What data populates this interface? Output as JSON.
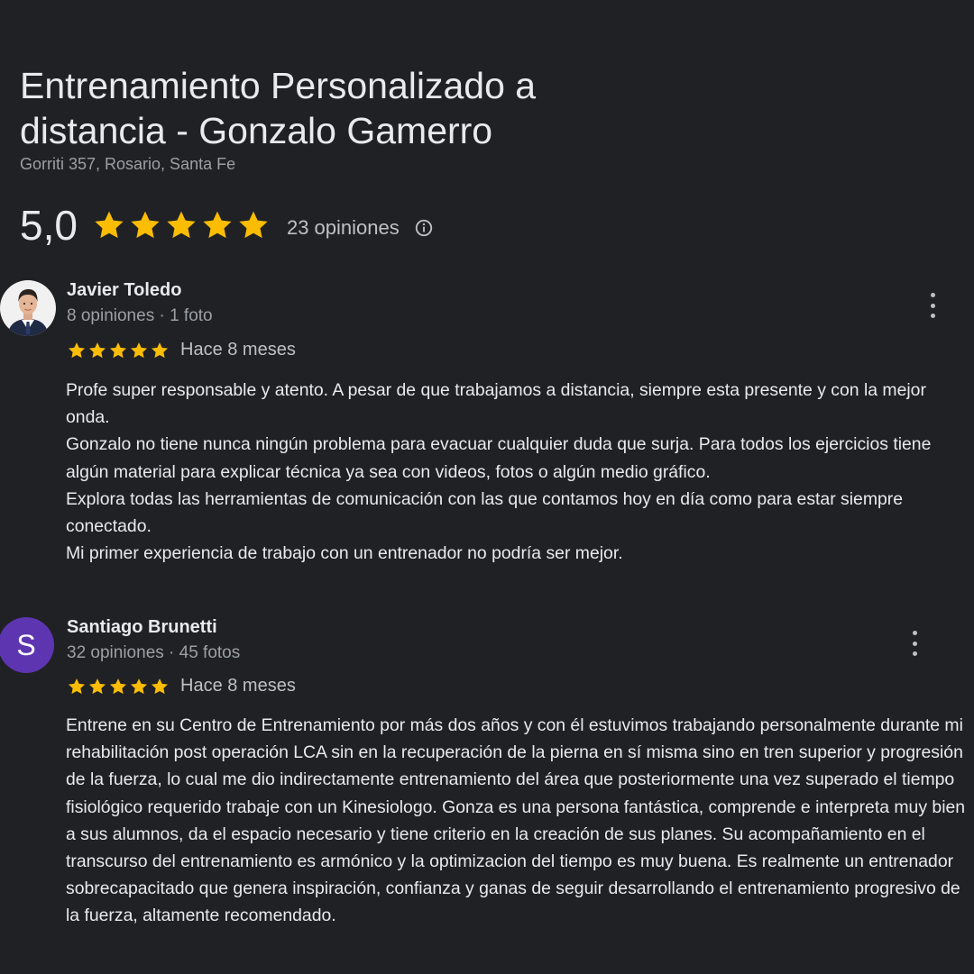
{
  "place": {
    "title": "Entrenamiento Personalizado a distancia - Gonzalo Gamerro",
    "address": "Gorriti 357, Rosario, Santa Fe",
    "rating": "5,0",
    "stars": 5,
    "reviews_count": "23 opiniones"
  },
  "colors": {
    "star": "#fbbc04",
    "avatar_letter_bg": "#5e35b1",
    "background": "#202124"
  },
  "icons": {
    "info": "info-icon",
    "more": "more-vert-icon",
    "star": "star-icon"
  },
  "reviews": [
    {
      "name": "Javier Toledo",
      "meta": "8 opiniones · 1 foto",
      "stars": 5,
      "time": "Hace 8 meses",
      "lines": [
        "Profe super responsable y atento. A pesar de que trabajamos a distancia, siempre esta presente y con la mejor onda.",
        "Gonzalo no tiene nunca ningún problema para evacuar cualquier duda que surja. Para todos los ejercicios tiene algún material para explicar técnica ya sea con videos, fotos o algún medio gráfico.",
        "Explora todas las herramientas de comunicación con las que contamos hoy en día como para estar siempre conectado.",
        "Mi primer experiencia de trabajo con un entrenador no podría ser mejor."
      ]
    },
    {
      "name": "Santiago Brunetti",
      "avatar_letter": "S",
      "meta": "32 opiniones · 45 fotos",
      "stars": 5,
      "time": "Hace 8 meses",
      "lines": [
        "Entrene en su Centro de Entrenamiento por más dos años y con él estuvimos trabajando personalmente durante mi rehabilitación post operación LCA sin en la recuperación de la pierna en sí misma sino en tren superior y progresión de la fuerza, lo cual me dio indirectamente entrenamiento del área que posteriormente una vez superado el tiempo fisiológico requerido trabaje con un Kinesiologo. Gonza es una persona fantástica, comprende e interpreta muy bien a sus alumnos, da el espacio necesario y tiene criterio en la creación de sus planes. Su acompañamiento en el transcurso del entrenamiento es armónico y la optimizacion del tiempo es muy buena. Es realmente un entrenador sobrecapacitado que genera inspiración, confianza y ganas de seguir desarrollando el entrenamiento progresivo de la fuerza, altamente recomendado."
      ]
    }
  ]
}
